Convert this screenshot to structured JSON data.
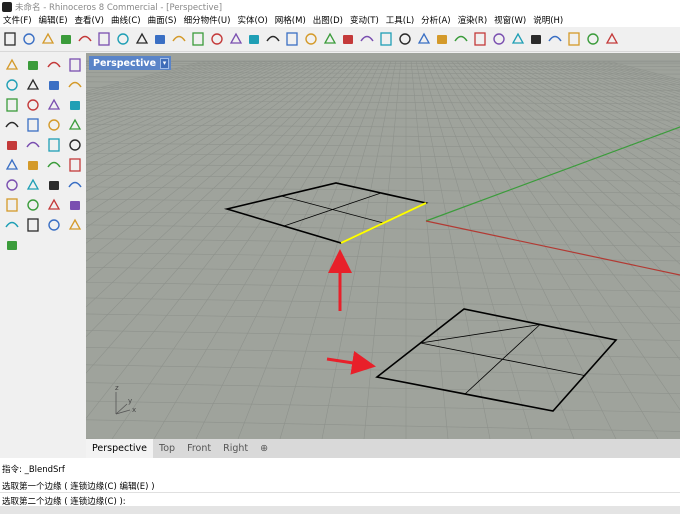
{
  "window": {
    "title": "未命名 - Rhinoceros 8 Commercial - [Perspective]"
  },
  "menu": [
    "文件(F)",
    "编辑(E)",
    "查看(V)",
    "曲线(C)",
    "曲面(S)",
    "细分物件(U)",
    "实体(O)",
    "网格(M)",
    "出图(D)",
    "变动(T)",
    "工具(L)",
    "分析(A)",
    "渲染(R)",
    "视窗(W)",
    "说明(H)"
  ],
  "viewport": {
    "label": "Perspective",
    "dropdown": "▾",
    "axis_x": "x",
    "axis_y": "y",
    "axis_z": "z"
  },
  "tabs": [
    "Perspective",
    "Top",
    "Front",
    "Right",
    "⊕"
  ],
  "command": {
    "line1": "指令: _BlendSrf",
    "line2": "选取第一个边缘 ( 连锁边缘(C)  编辑(E) )",
    "prompt": "选取第二个边缘 ( 连锁边缘(C) ):"
  },
  "colors": {
    "viewport_bg": "#9fa39c",
    "grid": "#8e928c",
    "x_axis": "#b23a33",
    "y_axis": "#3b9c3b",
    "selected_edge": "#ffff00",
    "arrow": "#e8202a",
    "tab_active": "#f3f3f3",
    "viewport_label": "#5a84c8"
  },
  "toolbar_icons": [
    "new-file-icon",
    "open-icon",
    "save-icon",
    "print-icon",
    "import-icon",
    "cut-icon",
    "copy-icon",
    "paste-icon",
    "undo-icon",
    "pan-icon",
    "rotate-view-icon",
    "zoom-icon",
    "zoom-window-icon",
    "zoom-extents-icon",
    "zoom-selected-icon",
    "undo-view-icon",
    "four-viewports-icon",
    "car-icon",
    "car-2-icon",
    "osnap-icon",
    "points-icon",
    "light-icon",
    "lock-icon",
    "material-icon",
    "color-wheel-icon",
    "circle-icon",
    "render-icon",
    "sphere-icon",
    "properties-icon",
    "gear-icon",
    "gumball-icon",
    "globe-icon",
    "help-icon"
  ],
  "left_tool_icons": [
    [
      "select-icon",
      "point-icon",
      "polyline-icon",
      "curve-icon"
    ],
    [
      "circle-tool-icon",
      "arc-icon",
      "rectangle-icon",
      "polygon-icon"
    ],
    [
      "ellipse-icon",
      "fillet-curve-icon",
      "offset-icon",
      "edit-points-icon"
    ],
    [
      "box-icon",
      "sphere-tool-icon",
      "cylinder-icon",
      "surface-icon"
    ],
    [
      "boolean-icon",
      "explode-icon",
      "extrude-icon",
      "loft-icon"
    ],
    [
      "group-icon",
      "blend-icon",
      "rebuild-icon",
      "fillet-surface-icon"
    ],
    [
      "text-icon",
      "dimension-icon",
      "array-icon",
      "layout-icon"
    ],
    [
      "mesh-icon",
      "hatch-icon",
      "grid-icon",
      "annotation-icon"
    ],
    [
      "analyze-icon",
      "check-icon",
      "curvature-icon",
      "shade-icon"
    ],
    [
      "render-tool-icon"
    ]
  ]
}
